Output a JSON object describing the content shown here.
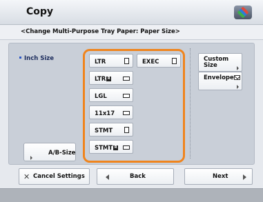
{
  "header": {
    "title": "Copy",
    "logo_icon": "canon-cube-icon"
  },
  "subtitle": "<Change Multi-Purpose Tray Paper: Paper Size>",
  "panel": {
    "group_label": "Inch Size",
    "sizes": {
      "ltr": "LTR",
      "ltr_r": "LTR",
      "lgl": "LGL",
      "s11x17": "11x17",
      "stmt": "STMT",
      "stmt_r": "STMT",
      "exec": "EXEC"
    },
    "r_badge": "R",
    "custom_size": "Custom Size",
    "envelope": "Envelope",
    "ab_size": "A/B-Size"
  },
  "footer": {
    "cancel": "Cancel Settings",
    "back": "Back",
    "next": "Next"
  },
  "colors": {
    "selection_frame": "#f0841c",
    "group_bullet": "#2a55c5"
  }
}
